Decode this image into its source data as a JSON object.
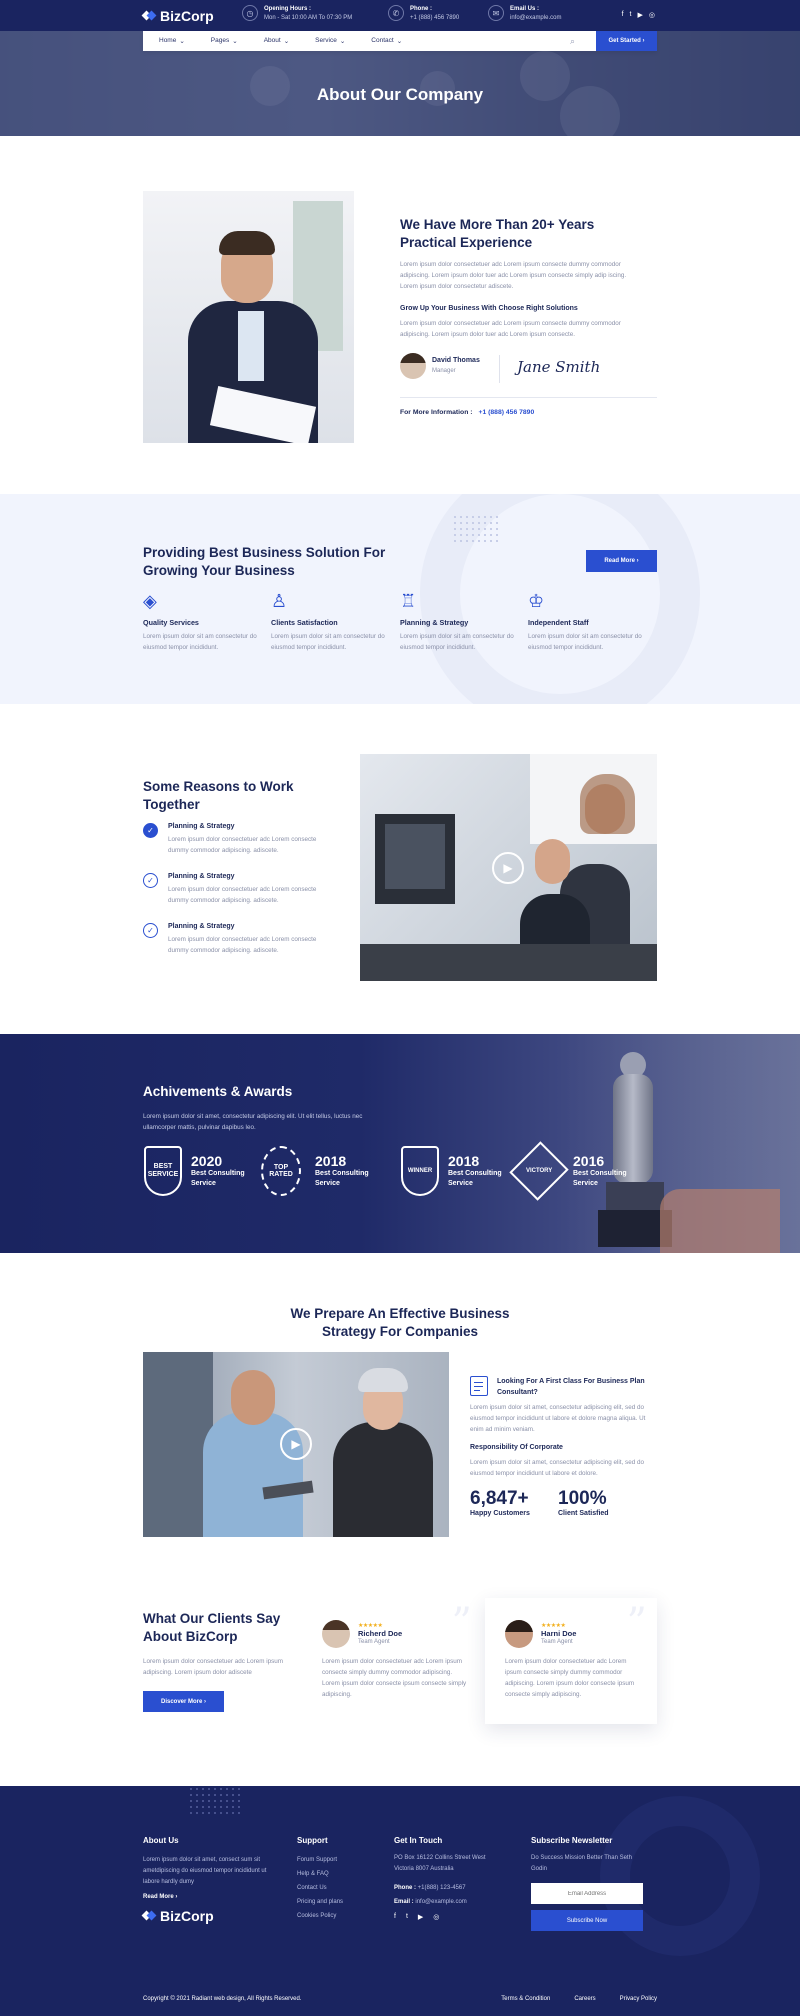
{
  "brand": {
    "name": "BizCorp"
  },
  "topbar": {
    "hours_label": "Opening Hours :",
    "hours_value": "Mon - Sat 10:00 AM To 07:30 PM",
    "phone_label": "Phone :",
    "phone_value": "+1 (888) 456 7890",
    "email_label": "Email Us :",
    "email_value": "info@example.com",
    "social": [
      "f",
      "t",
      "▶",
      "◎"
    ]
  },
  "nav": {
    "items": [
      "Home",
      "Pages",
      "About",
      "Service",
      "Contact"
    ],
    "cta": "Get Started ›"
  },
  "hero": {
    "title": "About Our Company"
  },
  "about": {
    "title_line1": "We Have More Than 20+ Years",
    "title_line2": "Practical Experience",
    "para1": "Lorem ipsum dolor consectetuer adc Lorem ipsum consecte dummy commodor adipiscing. Lorem ipsum dolor tuer adc Lorem ipsum consecte simply adip iscing. Lorem ipsum dolor consectetur adiscete.",
    "subtitle": "Grow Up Your Business With Choose Right Solutions",
    "para2": "Lorem ipsum dolor consectetuer adc Lorem ipsum consecte dummy commodor adipiscing. Lorem ipsum dolor tuer adc Lorem ipsum consecte.",
    "person_name": "David Thomas",
    "person_role": "Manager",
    "signature": "Jane Smith",
    "info_label": "For More Information :",
    "info_phone": "+1 (888) 456 7890"
  },
  "services": {
    "title_line1": "Providing Best Business Solution For",
    "title_line2": "Growing Your Business",
    "button": "Read More ›",
    "items": [
      {
        "title": "Quality Services",
        "text": "Lorem ipsum dolor sit am consectetur do eiusmod tempor incididunt."
      },
      {
        "title": "Clients Satisfaction",
        "text": "Lorem ipsum dolor sit am consectetur do eiusmod tempor incididunt."
      },
      {
        "title": "Planning & Strategy",
        "text": "Lorem ipsum dolor sit am consectetur do eiusmod tempor incididunt."
      },
      {
        "title": "Independent Staff",
        "text": "Lorem ipsum dolor sit am consectetur do eiusmod tempor incididunt."
      }
    ]
  },
  "reasons": {
    "title_line1": "Some Reasons to Work",
    "title_line2": "Together",
    "items": [
      {
        "title": "Planning & Strategy",
        "text": "Lorem ipsum dolor consectetuer adc Lorem consecte dummy commodor adipiscing. adiscete."
      },
      {
        "title": "Planning & Strategy",
        "text": "Lorem ipsum dolor consectetuer adc Lorem consecte dummy commodor adipiscing. adiscete."
      },
      {
        "title": "Planning & Strategy",
        "text": "Lorem ipsum dolor consectetuer adc Lorem consecte dummy commodor adipiscing. adiscete."
      }
    ]
  },
  "achievements": {
    "title": "Achivements & Awards",
    "text": "Lorem ipsum dolor sit amet, consectetur adipiscing elit. Ut elit tellus, luctus nec ullamcorper mattis, pulvinar dapibus leo.",
    "items": [
      {
        "year": "2020",
        "line1": "Best Consulting",
        "line2": "Service",
        "badge": "BEST SERVICE"
      },
      {
        "year": "2018",
        "line1": "Best Consulting",
        "line2": "Service",
        "badge": "TOP RATED"
      },
      {
        "year": "2018",
        "line1": "Best Consulting",
        "line2": "Service",
        "badge": "WINNER"
      },
      {
        "year": "2016",
        "line1": "Best Consulting",
        "line2": "Service",
        "badge": "VICTORY"
      }
    ]
  },
  "strategy": {
    "title_line1": "We Prepare An Effective Business",
    "title_line2": "Strategy For Companies",
    "q_title_line1": "Looking For A First Class For Business Plan",
    "q_title_line2": "Consultant?",
    "q_text": "Lorem ipsum dolor sit amet, consectetur adipiscing elit, sed do eiusmod tempor incididunt ut labore et dolore magna aliqua. Ut enim ad minim veniam.",
    "sub": "Responsibility Of Corporate",
    "sub_text": "Lorem ipsum dolor sit amet, consectetur adipiscing elit, sed do eiusmod tempor incididunt ut labore et dolore.",
    "stats": [
      {
        "value": "6,847+",
        "label": "Happy Customers"
      },
      {
        "value": "100%",
        "label": "Client Satisfied"
      }
    ]
  },
  "testimonials": {
    "title_line1": "What Our Clients Say",
    "title_line2": "About BizCorp",
    "text": "Lorem ipsum dolor consectetuer adc Lorem ipsum adipiscing. Lorem ipsum dolor adiscete",
    "button": "Discover More ›",
    "items": [
      {
        "name": "Richerd Doe",
        "role": "Team Agent",
        "stars": "★★★★★",
        "text": "Lorem ipsum dolor consectetuer adc Lorem ipsum consecte simply dummy commodor adipiscing. Lorem ipsum dolor consecte ipsum consecte simply adipiscing."
      },
      {
        "name": "Harni Doe",
        "role": "Team Agent",
        "stars": "★★★★★",
        "text": "Lorem ipsum dolor consectetuer adc Lorem ipsum consecte simply dummy commodor adipiscing. Lorem ipsum dolor consecte ipsum consecte simply adipiscing."
      }
    ]
  },
  "footer": {
    "about_title": "About Us",
    "about_text": "Lorem ipsum dolor sit amet, consect sum sit ametdipiscing do eiusmod tempor incididunt ut labore hardly dumy",
    "read_more": "Read More ›",
    "support_title": "Support",
    "support_links": [
      "Forum Support",
      "Help & FAQ",
      "Contact Us",
      "Pricing and plans",
      "Cookies Policy"
    ],
    "touch_title": "Get In Touch",
    "address_line1": "PO Box 16122 Collins Street West",
    "address_line2": "Victoria 8007 Australia",
    "phone_label": "Phone :",
    "phone_value": "+1(888) 123-4567",
    "email_label": "Email :",
    "email_value": "info@example.com",
    "news_title": "Subscribe Newsletter",
    "news_text": "Do Success Mission Better Than Seth Godin",
    "email_placeholder": "Email Address",
    "subscribe": "Subscribe Now",
    "copyright": "Copyright © 2021 Radiant web design, All Rights Reserved.",
    "bottom_links": [
      "Terms & Condition",
      "Careers",
      "Privacy Policy"
    ]
  }
}
